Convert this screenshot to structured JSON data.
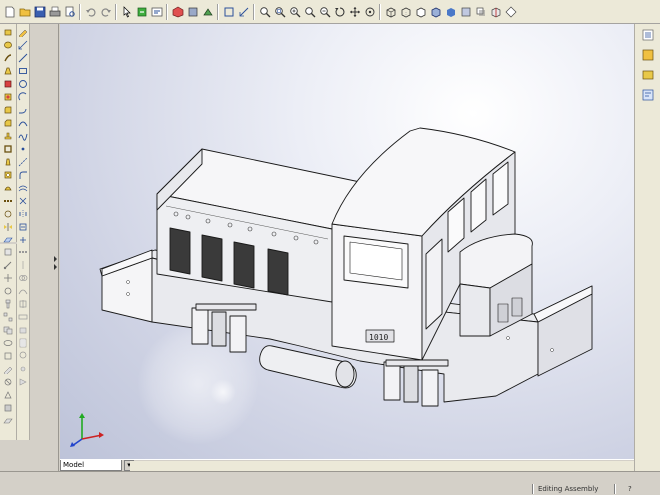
{
  "viewport": {
    "tab_label": "Model",
    "tab_arrow": "▾"
  },
  "model": {
    "plate_text": "1010"
  },
  "status": {
    "left_text": "",
    "mid_text": "Editing Assembly",
    "right_text": "?"
  },
  "colors": {
    "toolbar_bg": "#ece9d8",
    "panel_bg": "#d4d0c8",
    "model_face": "#f2f2f4",
    "model_shade": "#dfe0e6",
    "model_edge": "#1a1a1a",
    "axis_x": "#cc2222",
    "axis_y": "#22aa22",
    "axis_z": "#2244cc"
  },
  "icons": {
    "main_toolbar": [
      "new-icon",
      "open-icon",
      "save-icon",
      "print-icon",
      "print-preview-icon",
      "undo-icon",
      "redo-icon",
      "select-icon",
      "rebuild-icon",
      "options-icon",
      "zoom-to-fit-icon",
      "zoom-area-icon",
      "zoom-in-icon",
      "rotate-icon",
      "pan-icon",
      "view-orientation-icon",
      "wireframe-icon",
      "hidden-lines-icon",
      "shaded-icon",
      "section-view-icon"
    ],
    "right_toolbar": [
      "feature-manager-icon",
      "property-manager-icon",
      "configuration-manager-icon",
      "display-manager-icon"
    ]
  }
}
